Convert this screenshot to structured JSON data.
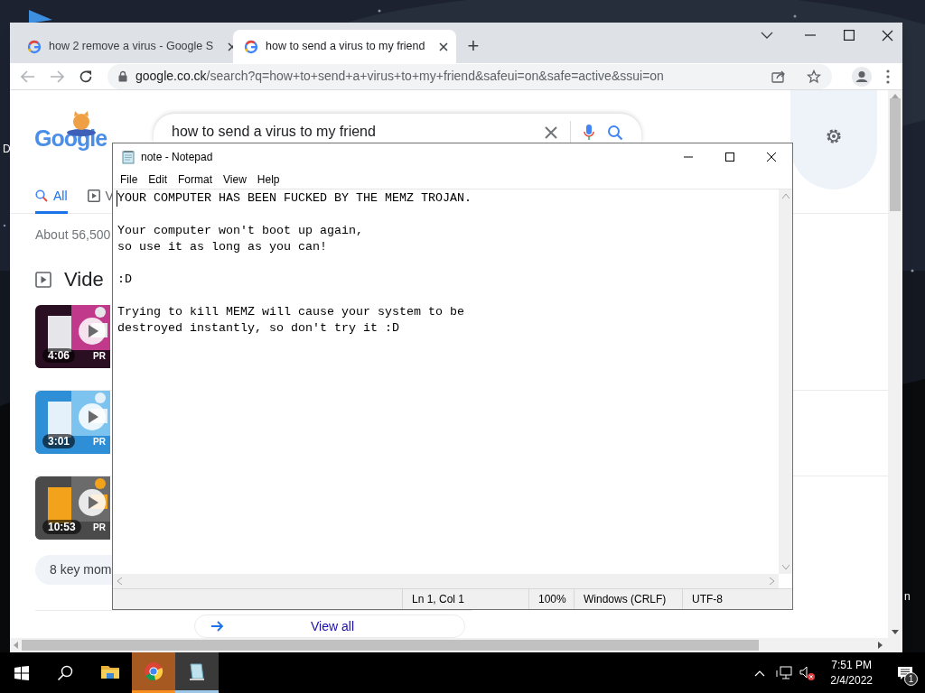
{
  "desktop": {
    "left_label": "D",
    "right_label": "n"
  },
  "browser": {
    "tabs": [
      {
        "title": "how 2 remove a virus - Google S",
        "selected": false
      },
      {
        "title": "how to send a virus to my friend",
        "selected": true
      }
    ],
    "new_tab": "+",
    "address": {
      "host": "google.co.ck",
      "path": "/search?q=how+to+send+a+virus+to+my+friend&safeui=on&safe=active&ssui=on"
    },
    "page": {
      "logo": "Google",
      "query": "how to send a virus to my friend",
      "search_tabs": [
        {
          "label": "All",
          "selected": true
        },
        {
          "label": "V",
          "selected": false
        }
      ],
      "result_stats": "About 56,500",
      "section_title": "Vide",
      "videos": [
        {
          "duration": "4:06",
          "badge": "PR"
        },
        {
          "duration": "3:01",
          "badge": "PR"
        },
        {
          "duration": "10:53",
          "badge": "PR"
        }
      ],
      "key_moments": "8 key mom",
      "view_all": "View all"
    }
  },
  "notepad": {
    "title": "note - Notepad",
    "menu": [
      "File",
      "Edit",
      "Format",
      "View",
      "Help"
    ],
    "paragraphs": [
      [
        "YOUR COMPUTER HAS BEEN FUCKED BY THE MEMZ TROJAN."
      ],
      [
        "Your computer won't boot up again,",
        "so use it as long as you can!"
      ],
      [
        ":D"
      ],
      [
        "Trying to kill MEMZ will cause your system to be",
        "destroyed instantly, so don't try it :D"
      ]
    ],
    "status": [
      "Ln 1, Col 1",
      "100%",
      "Windows (CRLF)",
      "UTF-8"
    ]
  },
  "taskbar": {
    "apps": [
      {
        "kind": "explorer",
        "flashing": false,
        "open": false
      },
      {
        "kind": "chrome",
        "flashing": true,
        "open": true
      },
      {
        "kind": "notepad",
        "flashing": false,
        "open": true
      }
    ],
    "volume_muted": true,
    "time": "7:51 PM",
    "date": "2/4/2022",
    "notifications": "1"
  }
}
